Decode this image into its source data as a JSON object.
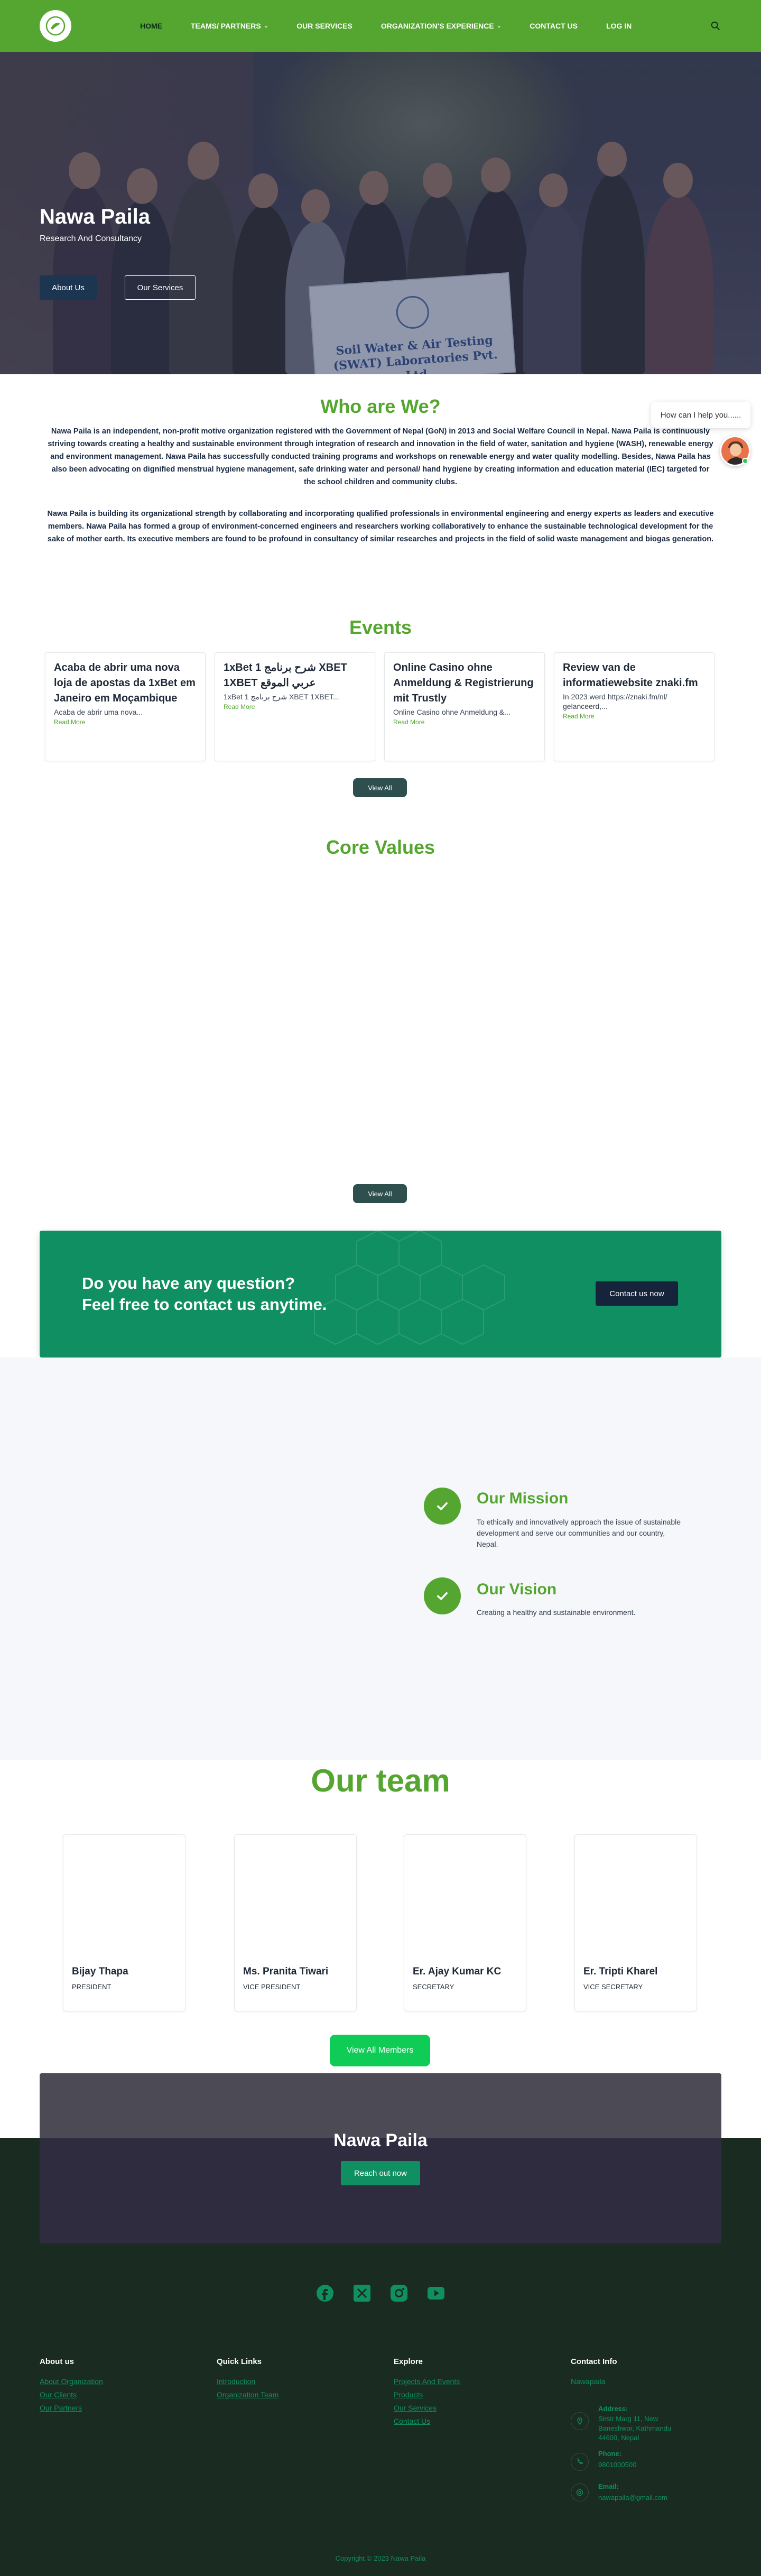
{
  "header": {
    "nav": [
      "HOME",
      "TEAMS/ PARTNERS",
      "OUR SERVICES",
      "ORGANIZATION'S EXPERIENCE",
      "CONTACT US",
      "LOG IN"
    ],
    "caret": "⌄"
  },
  "hero": {
    "title": "Nawa Paila",
    "subtitle": "Research And Consultancy",
    "btn_about": "About Us",
    "btn_services": "Our Services",
    "banner": "Soil Water & Air Testing (SWAT) Laboratories Pvt. Ltd"
  },
  "chat": {
    "prompt": "How can I help you......"
  },
  "who": {
    "title": "Who are We?",
    "p1": "Nawa Paila is an independent, non-profit motive organization registered with the Government of Nepal (GoN) in 2013 and Social Welfare Council in Nepal. Nawa Paila is continuously striving towards creating a healthy and sustainable environment through integration of research and innovation in the field of water, sanitation and hygiene (WASH), renewable energy and environment management. Nawa Paila has successfully conducted training programs and workshops on renewable energy and water quality modelling. Besides, Nawa Paila has also been advocating on dignified menstrual hygiene management, safe drinking water and personal/ hand hygiene by creating information and education material (IEC) targeted for the school children and community clubs.",
    "p2": "Nawa Paila is building its organizational strength by collaborating and incorporating qualified professionals in environmental engineering and energy experts as leaders and executive members. Nawa Paila has formed a group of environment-concerned engineers and researchers working collaboratively to enhance the sustainable technological development for the sake of mother earth. Its executive members are found to be profound in consultancy of similar researches and projects in the field of solid waste management and biogas generation."
  },
  "events": {
    "title": "Events",
    "items": [
      {
        "title": "Acaba de abrir uma nova loja de apostas da 1xBet em Janeiro em Moçambique",
        "excerpt": "Acaba de abrir uma nova...",
        "more": "Read More"
      },
      {
        "title": "1xBet 1 شرح برنامج XBET 1XBET عربي الموقع",
        "excerpt": "1xBet 1 شرح برنامج XBET 1XBET...",
        "more": "Read More"
      },
      {
        "title": "Online Casino ohne Anmeldung & Registrierung mit Trustly",
        "excerpt": "Online Casino ohne Anmeldung &...",
        "more": "Read More"
      },
      {
        "title": "Review van de informatiewebsite znaki.fm",
        "excerpt": "In 2023 werd https://znaki.fm/nl/ gelanceerd,...",
        "more": "Read More"
      }
    ],
    "view_all": "View All"
  },
  "core": {
    "title": "Core Values",
    "view_all": "View All"
  },
  "cta": {
    "line1": "Do you have any question?",
    "line2": "Feel free to contact us anytime.",
    "button": "Contact us now"
  },
  "mission": {
    "title": "Our Mission",
    "text": "To ethically and innovatively approach the issue of sustainable development and serve our communities and our country, Nepal.",
    "vision_title": "Our Vision",
    "vision_text": "Creating a healthy and sustainable environment."
  },
  "team": {
    "title": "Our team",
    "members": [
      {
        "name": "Bijay Thapa",
        "role": "PRESIDENT"
      },
      {
        "name": "Ms. Pranita Tiwari",
        "role": "VICE PRESIDENT"
      },
      {
        "name": "Er. Ajay Kumar KC",
        "role": "SECRETARY"
      },
      {
        "name": "Er. Tripti Kharel",
        "role": "VICE SECRETARY"
      }
    ],
    "view_all": "View All Members"
  },
  "reach": {
    "title": "Nawa Paila",
    "button": "Reach out now"
  },
  "footer": {
    "about": {
      "head": "About us",
      "links": [
        "About Organization",
        "Our Clients",
        "Our Partners"
      ]
    },
    "quick": {
      "head": "Quick Links",
      "links": [
        "Introduction",
        "Organization Team"
      ]
    },
    "explore": {
      "head": "Explore",
      "links": [
        "Projects And Events",
        "Products",
        "Our Services",
        "Contact Us"
      ]
    },
    "contact": {
      "head": "Contact Info",
      "org": "Nawapaila",
      "address_label": "Address:",
      "address": "Sirsir Marg 11, New Baneshwor, Kathmandu 44600, Nepal",
      "phone_label": "Phone:",
      "phone": "9801000500",
      "email_label": "Email:",
      "email": "nawapaila@gmail.com"
    },
    "copyright": "Copyright © 2023 Nawa Paila"
  },
  "colors": {
    "brand_green": "#55a630",
    "teal": "#0f8f62",
    "footer_bg": "#1a2c22"
  }
}
